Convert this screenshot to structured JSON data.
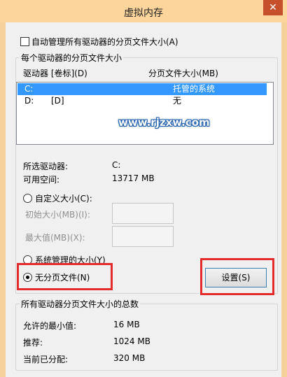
{
  "window": {
    "title": "虚拟内存",
    "close_glyph": "✕"
  },
  "auto_manage": {
    "label": "自动管理所有驱动器的分页文件大小(A)",
    "checked": false
  },
  "drive_group": {
    "title": "每个驱动器的分页文件大小",
    "columns": [
      "驱动器 [卷标](D)",
      "分页文件大小(MB)"
    ],
    "rows": [
      {
        "drive": "C:",
        "label": "",
        "size": "托管的系统",
        "selected": true
      },
      {
        "drive": "D:",
        "label": "[D]",
        "size": "无",
        "selected": false
      }
    ],
    "selected_drive_label": "所选驱动器:",
    "selected_drive_value": "C:",
    "free_space_label": "可用空间:",
    "free_space_value": "13717 MB",
    "custom_size_label": "自定义大小(C):",
    "initial_size_label": "初始大小(MB)(I):",
    "max_size_label": "最大值(MB)(X):",
    "system_managed_label": "系统管理的大小(Y)",
    "no_paging_label": "无分页文件(N)",
    "selected_option": "no_paging",
    "set_button": "设置(S)"
  },
  "watermark": "www.rjzxw.com",
  "totals_group": {
    "title": "所有驱动器分页文件大小的总数",
    "min_allowed_label": "允许的最小值:",
    "min_allowed_value": "16 MB",
    "recommended_label": "推荐:",
    "recommended_value": "1024 MB",
    "allocated_label": "当前已分配:",
    "allocated_value": "320 MB"
  },
  "colors": {
    "title_bar": "#fbd59b",
    "selection": "#3399ff",
    "highlight_box": "#e42b2b",
    "close_button": "#c7502c"
  }
}
